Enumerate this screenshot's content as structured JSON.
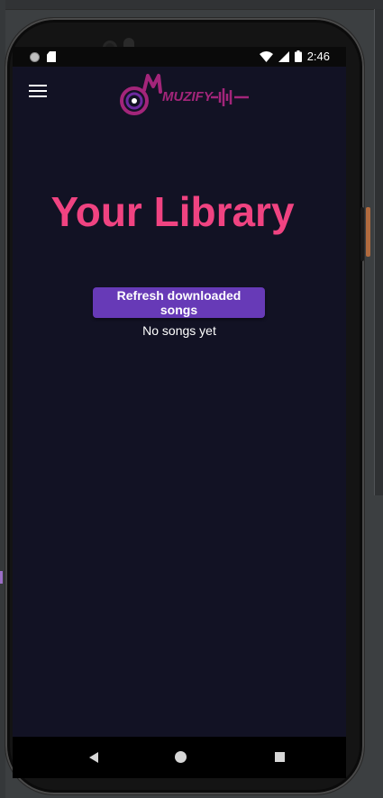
{
  "status_bar": {
    "time": "2:46",
    "icons": [
      "notification-dot-icon",
      "sd-card-icon",
      "wifi-icon",
      "cell-signal-icon",
      "battery-icon"
    ]
  },
  "app_bar": {
    "menu_icon": "hamburger-menu-icon",
    "logo_text": "MUZIFY"
  },
  "library": {
    "title": "Your Library",
    "refresh_label": "Refresh downloaded songs",
    "empty_message": "No songs yet"
  },
  "nav_bar": {
    "icons": [
      "back-triangle-icon",
      "home-circle-icon",
      "recents-square-icon"
    ]
  },
  "colors": {
    "screen_bg": "#121224",
    "title": "#f04381",
    "button": "#673ab7",
    "logo": "#a3257a"
  }
}
